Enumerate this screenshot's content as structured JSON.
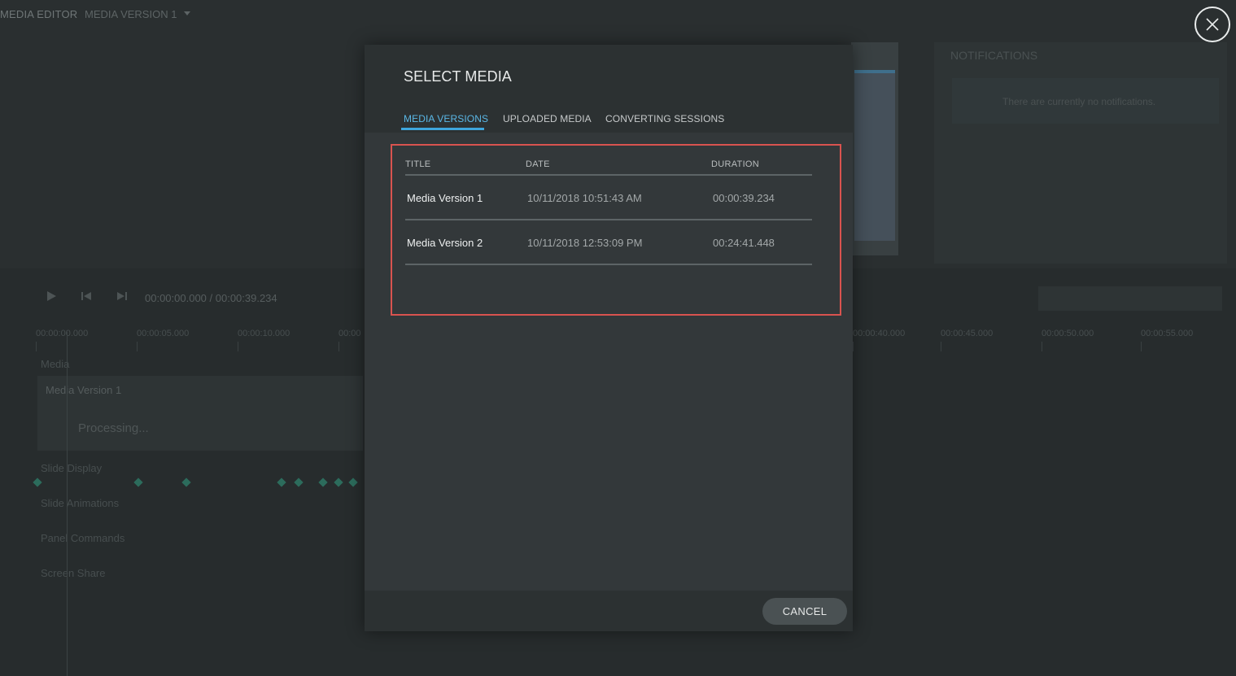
{
  "background": {
    "app_title": "MEDIA EDITOR",
    "version_selector": "MEDIA VERSION 1",
    "notifications_title": "NOTIFICATIONS",
    "notifications_empty": "There are currently no notifications.",
    "time_display": "00:00:00.000  /  00:00:39.234",
    "ruler_ticks": [
      "00:00:00.000",
      "00:00:05.000",
      "00:00:10.000",
      "00:00",
      "00:00:40.000",
      "00:00:45.000",
      "00:00:50.000",
      "00:00:55.000"
    ],
    "tracks": [
      "Media",
      "Slide Display",
      "Slide Animations",
      "Panel Commands",
      "Screen Share"
    ],
    "media_track_title": "Media Version 1",
    "media_track_status": "Processing..."
  },
  "modal": {
    "title": "SELECT MEDIA",
    "tabs": [
      {
        "label": "MEDIA VERSIONS",
        "active": true
      },
      {
        "label": "UPLOADED MEDIA",
        "active": false
      },
      {
        "label": "CONVERTING SESSIONS",
        "active": false
      }
    ],
    "table": {
      "columns": [
        "TITLE",
        "DATE",
        "DURATION"
      ],
      "rows": [
        {
          "title": "Media Version 1",
          "date": "10/11/2018 10:51:43 AM",
          "duration": "00:00:39.234"
        },
        {
          "title": "Media Version 2",
          "date": "10/11/2018 12:53:09 PM",
          "duration": "00:24:41.448"
        }
      ]
    },
    "cancel_label": "CANCEL"
  },
  "colors": {
    "accent": "#3ea6dc",
    "highlight_border": "#d9534f",
    "modal_bg": "#33383a"
  },
  "icons": {
    "close": "close-icon",
    "play": "play-icon",
    "skip_back": "skip-back-icon",
    "skip_forward": "skip-forward-icon"
  }
}
